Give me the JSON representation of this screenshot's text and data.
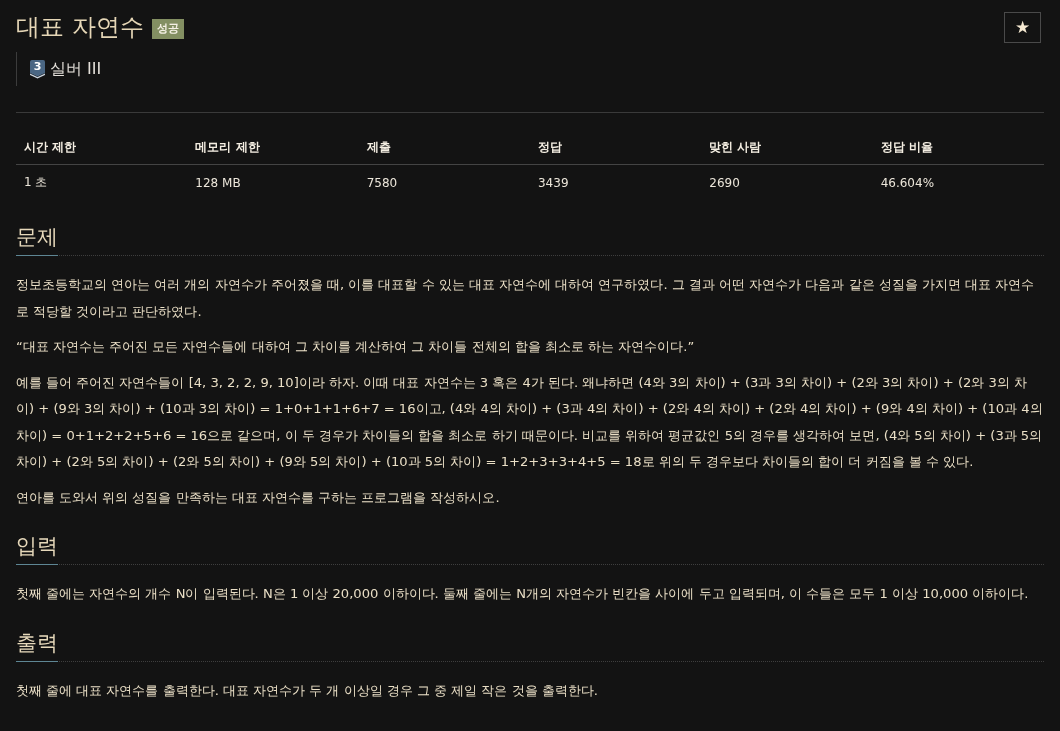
{
  "problem": {
    "title": "대표 자연수",
    "result_badge": "성공",
    "star_button": "★"
  },
  "tier": {
    "number": "3",
    "label": "실버 III"
  },
  "info_table": {
    "columns": [
      "시간 제한",
      "메모리 제한",
      "제출",
      "정답",
      "맞힌 사람",
      "정답 비율"
    ],
    "rows": [
      [
        "1 초",
        "128 MB",
        "7580",
        "3439",
        "2690",
        "46.604%"
      ]
    ]
  },
  "sections": [
    {
      "heading": "문제",
      "paragraphs": [
        "정보초등학교의 연아는 여러 개의 자연수가 주어졌을 때, 이를 대표할 수 있는 대표 자연수에 대하여 연구하였다. 그 결과 어떤 자연수가 다음과 같은 성질을 가지면 대표 자연수로 적당할 것이라고 판단하였다.",
        "“대표 자연수는 주어진 모든 자연수들에 대하여 그 차이를 계산하여 그 차이들 전체의 합을 최소로 하는 자연수이다.”",
        "예를 들어 주어진 자연수들이 [4, 3, 2, 2, 9, 10]이라 하자. 이때 대표 자연수는 3 혹은 4가 된다. 왜냐하면 (4와 3의 차이) + (3과 3의 차이) + (2와 3의 차이) + (2와 3의 차이) + (9와 3의 차이) + (10과 3의 차이) = 1+0+1+1+6+7 = 16이고, (4와 4의 차이) + (3과 4의 차이) + (2와 4의 차이) + (2와 4의 차이) + (9와 4의 차이) + (10과 4의 차이) = 0+1+2+2+5+6 = 16으로 같으며, 이 두 경우가 차이들의 합을 최소로 하기 때문이다. 비교를 위하여 평균값인 5의 경우를 생각하여 보면, (4와 5의 차이) + (3과 5의 차이) + (2와 5의 차이) + (2와 5의 차이) + (9와 5의 차이) + (10과 5의 차이) = 1+2+3+3+4+5 = 18로 위의 두 경우보다 차이들의 합이 더 커짐을 볼 수 있다.",
        "연아를 도와서 위의 성질을 만족하는 대표 자연수를 구하는 프로그램을 작성하시오."
      ]
    },
    {
      "heading": "입력",
      "paragraphs": [
        "첫째 줄에는 자연수의 개수 N이 입력된다. N은 1 이상 20,000 이하이다. 둘째 줄에는 N개의 자연수가 빈칸을 사이에 두고 입력되며, 이 수들은 모두 1 이상 10,000 이하이다."
      ]
    },
    {
      "heading": "출력",
      "paragraphs": [
        "첫째 줄에 대표 자연수를 출력한다. 대표 자연수가 두 개 이상일 경우 그 중 제일 작은 것을 출력한다."
      ]
    }
  ]
}
